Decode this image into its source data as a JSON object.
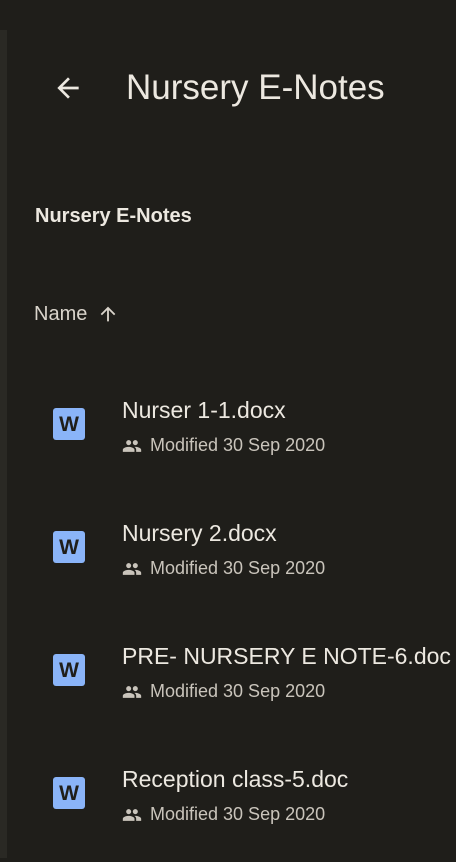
{
  "header": {
    "title": "Nursery E-Notes",
    "back_icon": "arrow-back-icon"
  },
  "breadcrumb": "Nursery E-Notes",
  "sort": {
    "label": "Name",
    "icon": "arrow-up-icon"
  },
  "files": [
    {
      "name": "Nurser 1-1.docx",
      "modified": "Modified 30 Sep 2020",
      "type_icon": "word-doc-icon",
      "badge": "W",
      "shared_icon": "people-icon"
    },
    {
      "name": "Nursery 2.docx",
      "modified": "Modified 30 Sep 2020",
      "type_icon": "word-doc-icon",
      "badge": "W",
      "shared_icon": "people-icon"
    },
    {
      "name": "PRE- NURSERY E NOTE-6.doc",
      "modified": "Modified 30 Sep 2020",
      "type_icon": "word-doc-icon",
      "badge": "W",
      "shared_icon": "people-icon"
    },
    {
      "name": "Reception class-5.doc",
      "modified": "Modified 30 Sep 2020",
      "type_icon": "word-doc-icon",
      "badge": "W",
      "shared_icon": "people-icon"
    }
  ],
  "colors": {
    "background": "#1f1e1a",
    "word_icon": "#8ab4f8",
    "text": "#ece8e0"
  }
}
